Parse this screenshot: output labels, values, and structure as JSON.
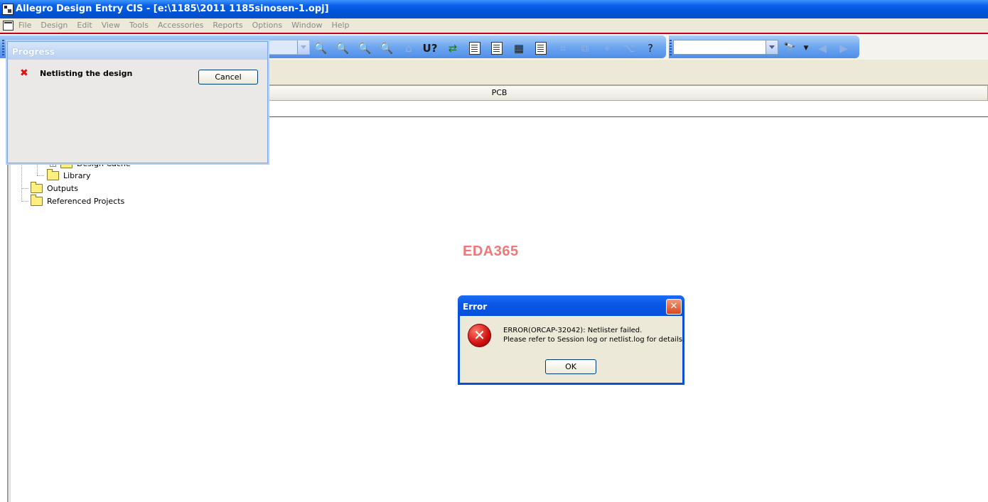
{
  "window": {
    "title": "Allegro Design Entry CIS - [e:\\1185\\2011 1185sinosen-1.opj]"
  },
  "menu": [
    "File",
    "Design",
    "Edit",
    "View",
    "Tools",
    "Accessories",
    "Reports",
    "Options",
    "Window",
    "Help"
  ],
  "toolbar": {
    "zoom_icons": [
      "zoom-in-icon",
      "zoom-out-icon",
      "zoom-area-icon",
      "zoom-all-icon"
    ],
    "help_glyph": "?",
    "search_glyph": "⌂"
  },
  "project": {
    "column_header": "PCB",
    "tree": {
      "design_cache": "Design Cache",
      "library": "Library",
      "outputs": "Outputs",
      "referenced_projects": "Referenced Projects"
    }
  },
  "watermark": "EDA365",
  "progress_dialog": {
    "title": "Progress",
    "message": "Netlisting the design",
    "cancel_label": "Cancel",
    "status_glyph": "✖"
  },
  "error_dialog": {
    "title": "Error",
    "close_glyph": "✕",
    "icon_glyph": "✕",
    "line1": "ERROR(ORCAP-32042): Netlister failed.",
    "line2": "Please refer to Session log or netlist.log for details.",
    "ok_label": "OK"
  }
}
